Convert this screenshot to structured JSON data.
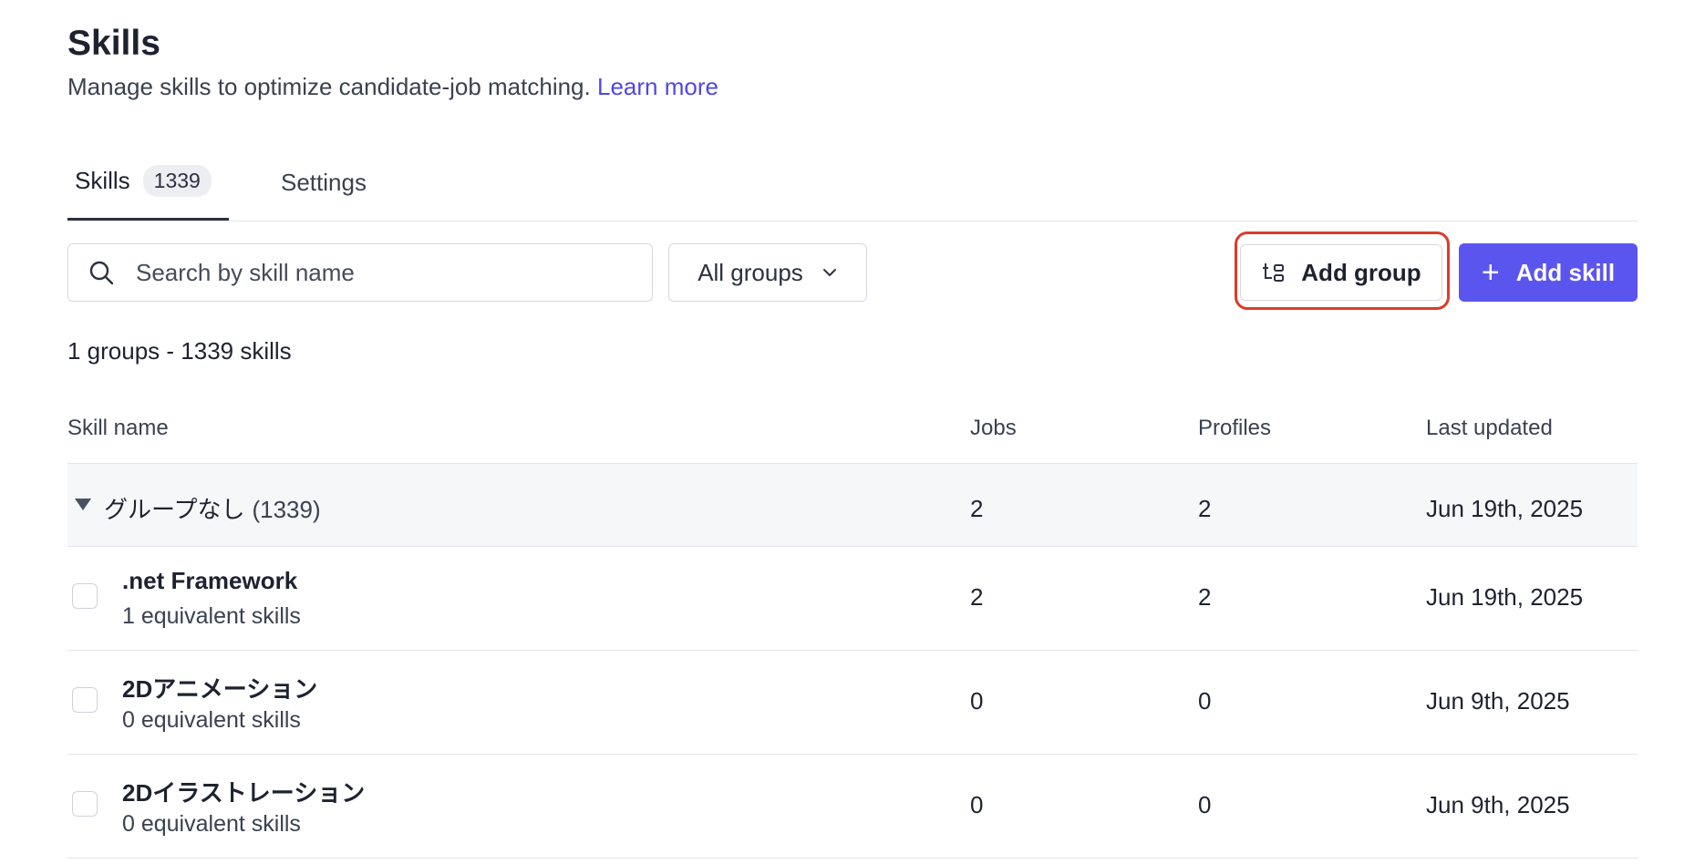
{
  "header": {
    "title": "Skills",
    "subtitle": "Manage skills to optimize candidate-job matching.",
    "learn_more": "Learn more"
  },
  "tabs": [
    {
      "label": "Skills",
      "count": "1339"
    },
    {
      "label": "Settings"
    }
  ],
  "search": {
    "placeholder": "Search by skill name",
    "icon": "search-icon"
  },
  "group_filter": {
    "selected": "All groups"
  },
  "buttons": {
    "add_group": "Add group",
    "add_skill": "Add skill"
  },
  "summary": "1 groups - 1339 skills",
  "table": {
    "columns": [
      "Skill name",
      "Jobs",
      "Profiles",
      "Last updated"
    ],
    "group": {
      "name": "グループなし",
      "count": "(1339)",
      "jobs": "2",
      "profiles": "2",
      "updated": "Jun 19th, 2025"
    },
    "rows": [
      {
        "name": ".net Framework",
        "equivalent": "1 equivalent skills",
        "jobs": "2",
        "profiles": "2",
        "updated": "Jun 19th, 2025"
      },
      {
        "name": "2Dアニメーション",
        "equivalent": "0 equivalent skills",
        "jobs": "0",
        "profiles": "0",
        "updated": "Jun 9th, 2025"
      },
      {
        "name": "2Dイラストレーション",
        "equivalent": "0 equivalent skills",
        "jobs": "0",
        "profiles": "0",
        "updated": "Jun 9th, 2025"
      }
    ]
  },
  "colors": {
    "accent": "#5b55f0",
    "link": "#5046e5",
    "highlight": "#dd3b2a"
  }
}
